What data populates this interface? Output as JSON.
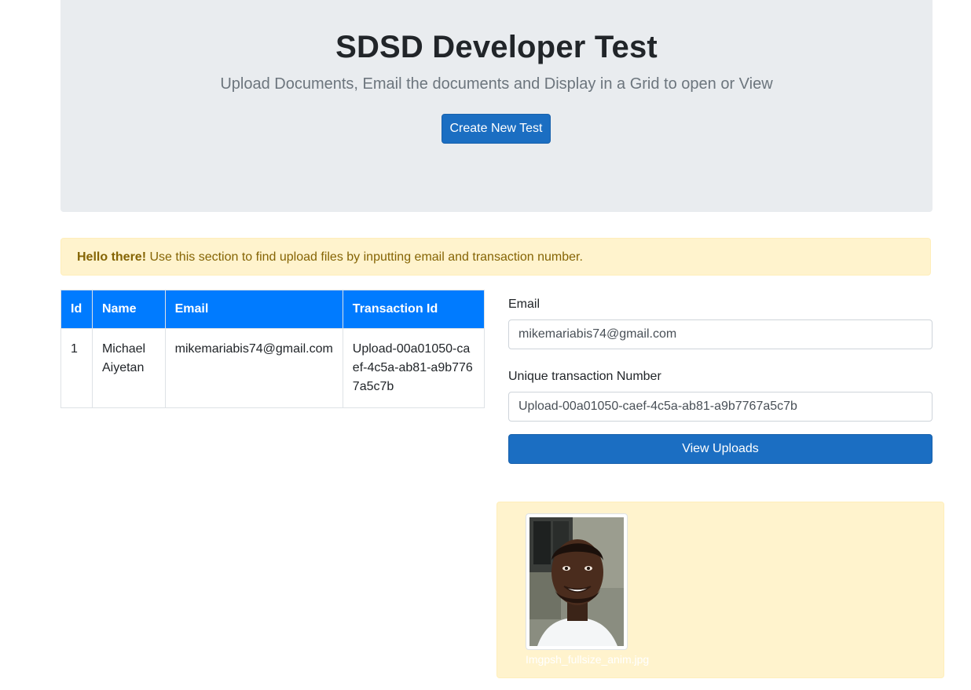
{
  "header": {
    "title": "SDSD Developer Test",
    "subtitle": "Upload Documents, Email the documents and Display in a Grid to open or View",
    "create_button": "Create New Test"
  },
  "alert": {
    "strong": "Hello there!",
    "message": " Use this section to find upload files by inputting email and transaction number."
  },
  "table": {
    "headers": [
      "Id",
      "Name",
      "Email",
      "Transaction Id"
    ],
    "rows": [
      {
        "id": "1",
        "name": "Michael Aiyetan",
        "email": "mikemariabis74@gmail.com",
        "transaction_id": "Upload-00a01050-caef-4c5a-ab81-a9b7767a5c7b"
      }
    ]
  },
  "form": {
    "email_label": "Email",
    "email_value": "mikemariabis74@gmail.com",
    "txn_label": "Unique transaction Number",
    "txn_value": "Upload-00a01050-caef-4c5a-ab81-a9b7767a5c7b",
    "submit_label": "View Uploads"
  },
  "gallery": {
    "file_name": "Imgpsh_fullsize_anim.jpg"
  },
  "colors": {
    "primary_button": "#1b6ec2",
    "table_header": "#007bff",
    "alert_bg": "#fff3cd",
    "jumbotron_bg": "#e9ecef"
  }
}
